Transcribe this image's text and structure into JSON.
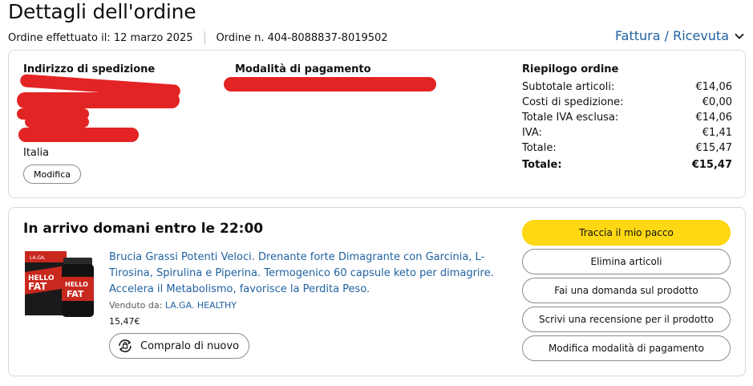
{
  "page": {
    "title": "Dettagli dell'ordine",
    "order_date_label": "Ordine effettuato il: 12 marzo 2025",
    "order_number_label": "Ordine n. 404-8088837-8019502",
    "invoice_link": "Fattura / Ricevuta"
  },
  "shipping": {
    "title": "Indirizzo di spedizione",
    "country": "Italia",
    "edit_button": "Modifica"
  },
  "payment": {
    "title": "Modalità di pagamento"
  },
  "summary": {
    "title": "Riepilogo ordine",
    "rows": [
      {
        "label": "Subtotale articoli:",
        "value": "€14,06"
      },
      {
        "label": "Costi di spedizione:",
        "value": "€0,00"
      },
      {
        "label": "Totale IVA esclusa:",
        "value": "€14,06"
      },
      {
        "label": "IVA:",
        "value": "€1,41"
      },
      {
        "label": "Totale:",
        "value": "€15,47"
      },
      {
        "label": "Totale:",
        "value": "€15,47"
      }
    ]
  },
  "delivery": {
    "title": "In arrivo domani entro le 22:00",
    "product_title": "Brucia Grassi Potenti Veloci. Drenante forte Dimagrante con Garcinia, L-Tirosina, Spirulina e Piperina. Termogenico 60 capsule keto per dimagrire. Accelera il Metabolismo, favorisce la Perdita Peso.",
    "seller_label": "Venduto da:",
    "seller_name": "LA.GA. HEALTHY",
    "price": "15,47€",
    "buy_again": "Compralo di nuovo",
    "product_image_text_top": "LA.GA.",
    "product_image_text": "HELLO FAT"
  },
  "actions": [
    "Traccia il mio pacco",
    "Elimina articoli",
    "Fai una domanda sul prodotto",
    "Scrivi una recensione per il prodotto",
    "Modifica modalità di pagamento"
  ],
  "colors": {
    "link": "#2162a1",
    "primary_button": "#ffd814",
    "redaction": "#e32424"
  }
}
